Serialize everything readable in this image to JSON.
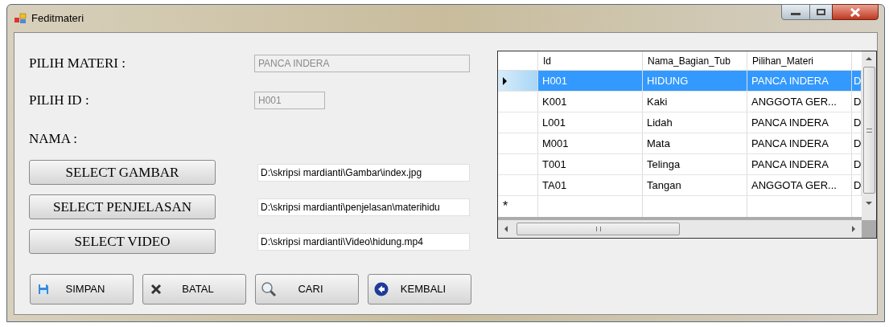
{
  "window": {
    "title": "Feditmateri"
  },
  "form": {
    "labels": [
      "PILIH MATERI :",
      "PILIH ID :",
      "NAMA :"
    ],
    "materi_field": {
      "value": "PANCA INDERA",
      "disabled": true
    },
    "id_field": {
      "value": "H001",
      "disabled": true
    },
    "file_rows": [
      {
        "button": "SELECT GAMBAR",
        "path": "D:\\skripsi mardianti\\Gambar\\index.jpg"
      },
      {
        "button": "SELECT PENJELASAN",
        "path": "D:\\skripsi mardianti\\penjelasan\\materihidu"
      },
      {
        "button": "SELECT VIDEO",
        "path": "D:\\skripsi mardianti\\Video\\hidung.mp4"
      }
    ],
    "actions": [
      {
        "kind": "save",
        "label": "SIMPAN"
      },
      {
        "kind": "cancel",
        "label": "BATAL"
      },
      {
        "kind": "search",
        "label": "CARI"
      },
      {
        "kind": "back",
        "label": "KEMBALI"
      }
    ]
  },
  "table": {
    "columns": [
      "Id",
      "Nama_Bagian_Tub",
      "Pilihan_Materi"
    ],
    "rows": [
      {
        "cells": [
          "H001",
          "HIDUNG",
          "PANCA INDERA",
          "D"
        ],
        "selected": true
      },
      {
        "cells": [
          "K001",
          "Kaki",
          "ANGGOTA GER...",
          "D"
        ],
        "selected": false
      },
      {
        "cells": [
          "L001",
          "Lidah",
          "PANCA INDERA",
          "D"
        ],
        "selected": false
      },
      {
        "cells": [
          "M001",
          "Mata",
          "PANCA INDERA",
          "D"
        ],
        "selected": false
      },
      {
        "cells": [
          "T001",
          "Telinga",
          "PANCA INDERA",
          "D"
        ],
        "selected": false
      },
      {
        "cells": [
          "TA01",
          "Tangan",
          "ANGGOTA GER...",
          "D"
        ],
        "selected": false
      }
    ],
    "new_row_marker": "*"
  }
}
